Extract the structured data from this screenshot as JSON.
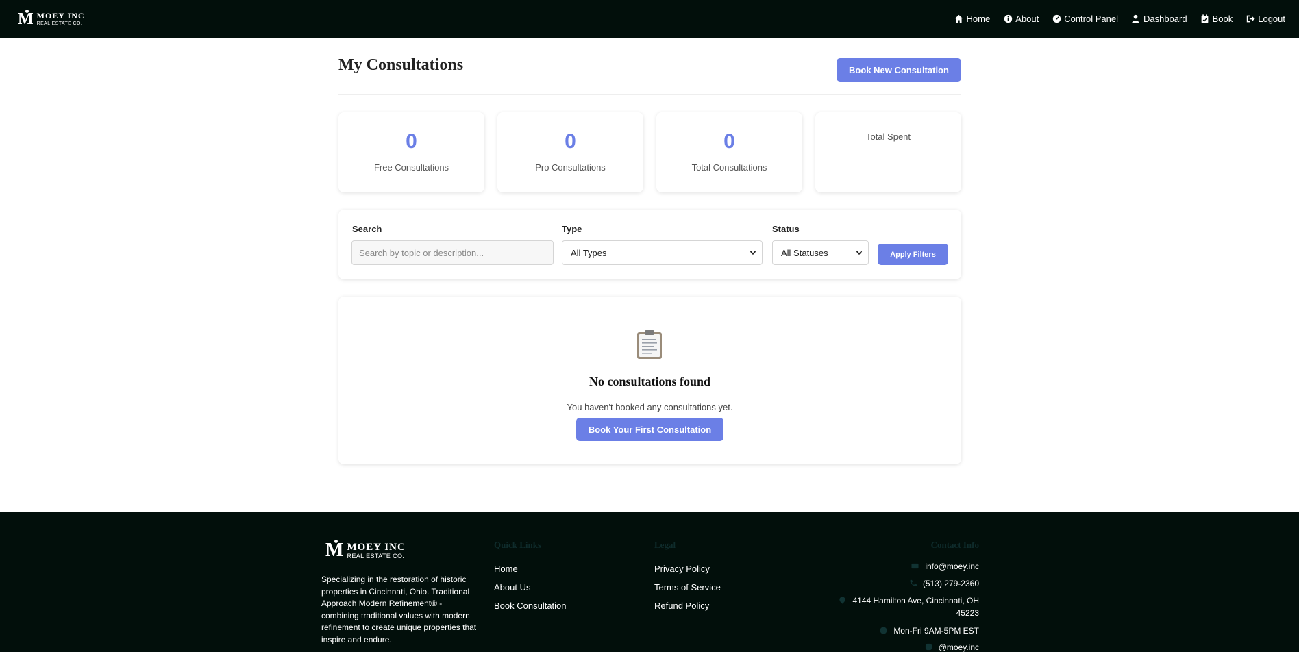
{
  "brand": {
    "name": "MOEY INC",
    "subtitle": "REAL ESTATE CO.",
    "mark": "M"
  },
  "nav": {
    "items": [
      {
        "label": "Home",
        "icon": "home-icon"
      },
      {
        "label": "About",
        "icon": "info-icon"
      },
      {
        "label": "Control Panel",
        "icon": "gauge-icon"
      },
      {
        "label": "Dashboard",
        "icon": "user-icon"
      },
      {
        "label": "Book",
        "icon": "calendar-check-icon"
      },
      {
        "label": "Logout",
        "icon": "logout-icon"
      }
    ]
  },
  "page": {
    "title": "My Consultations",
    "new_button": "Book New Consultation"
  },
  "stats": [
    {
      "value": "0",
      "label": "Free Consultations"
    },
    {
      "value": "0",
      "label": "Pro Consultations"
    },
    {
      "value": "0",
      "label": "Total Consultations"
    },
    {
      "value": "",
      "label": "Total Spent"
    }
  ],
  "filters": {
    "search_label": "Search",
    "search_placeholder": "Search by topic or description...",
    "type_label": "Type",
    "type_value": "All Types",
    "status_label": "Status",
    "status_value": "All Statuses",
    "apply_button": "Apply Filters"
  },
  "empty": {
    "icon": "clipboard-icon",
    "title": "No consultations found",
    "text": "You haven't booked any consultations yet.",
    "button": "Book Your First Consultation"
  },
  "footer": {
    "description": "Specializing in the restoration of historic properties in Cincinnati, Ohio. Traditional Approach Modern Refinement® - combining traditional values with modern refinement to create unique properties that inspire and endure.",
    "quick_links": {
      "title": "Quick Links",
      "items": [
        "Home",
        "About Us",
        "Book Consultation"
      ]
    },
    "legal": {
      "title": "Legal",
      "items": [
        "Privacy Policy",
        "Terms of Service",
        "Refund Policy"
      ]
    },
    "contact": {
      "title": "Contact Info",
      "email": "info@moey.inc",
      "phone": "(513) 279-2360",
      "address_line1": "4144 Hamilton Ave, Cincinnati, OH",
      "address_line2": "45223",
      "hours": "Mon-Fri 9AM-5PM EST",
      "social": "@moey.inc"
    }
  },
  "colors": {
    "nav_bg": "#020f0b",
    "accent": "#6b7fe6",
    "footer_heading": "#0f2c2c"
  }
}
